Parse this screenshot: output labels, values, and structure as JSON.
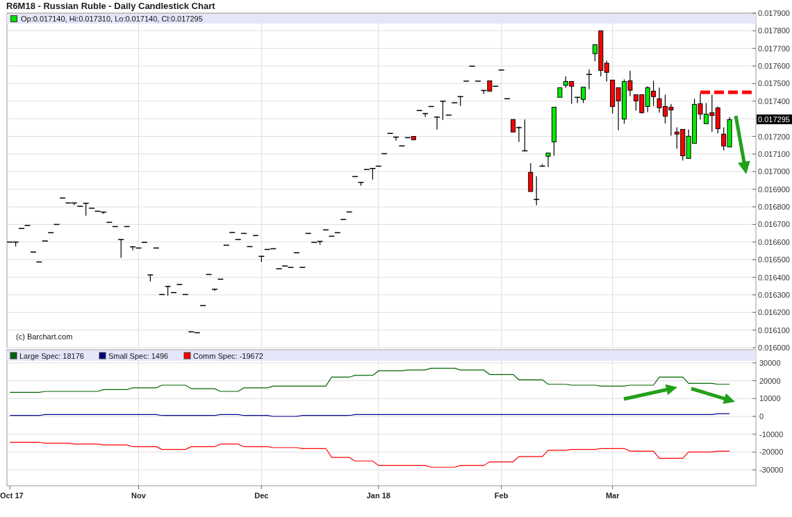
{
  "title": "R6M18 - Russian Ruble - Daily Candlestick Chart",
  "price_chart": {
    "legend": "Op:0.017140, Hi:0.017310, Lo:0.017140, Cl:0.017295",
    "credit": "(c) Barchart.com",
    "last_price_label": "0.017295",
    "chart_data": {
      "type": "candlestick",
      "grid": true,
      "ylim": [
        0.016,
        0.0179
      ],
      "yticks": [
        {
          "value": 0.0179,
          "label": "0.017900"
        },
        {
          "value": 0.0178,
          "label": "0.017800"
        },
        {
          "value": 0.0177,
          "label": "0.017700"
        },
        {
          "value": 0.0176,
          "label": "0.017600"
        },
        {
          "value": 0.0175,
          "label": "0.017500"
        },
        {
          "value": 0.0174,
          "label": "0.017400"
        },
        {
          "value": 0.0172,
          "label": "0.017200"
        },
        {
          "value": 0.0171,
          "label": "0.017100"
        },
        {
          "value": 0.017,
          "label": "0.017000"
        },
        {
          "value": 0.0169,
          "label": "0.016900"
        },
        {
          "value": 0.0168,
          "label": "0.016800"
        },
        {
          "value": 0.0167,
          "label": "0.016700"
        },
        {
          "value": 0.0166,
          "label": "0.016600"
        },
        {
          "value": 0.0165,
          "label": "0.016500"
        },
        {
          "value": 0.0164,
          "label": "0.016400"
        },
        {
          "value": 0.0163,
          "label": "0.016300"
        },
        {
          "value": 0.0162,
          "label": "0.016200"
        },
        {
          "value": 0.0161,
          "label": "0.016100"
        },
        {
          "value": 0.016,
          "label": "0.016000"
        }
      ],
      "categories": [
        null,
        null,
        null,
        null,
        null,
        null,
        null,
        null,
        null,
        null,
        null,
        null,
        null,
        null,
        null,
        null,
        null,
        null,
        null,
        null,
        null,
        null,
        null,
        null,
        null,
        null,
        null,
        null,
        null,
        null,
        null,
        null,
        null,
        null,
        null,
        null,
        null,
        null,
        null,
        null,
        null,
        null,
        null,
        null,
        null,
        null,
        null,
        null,
        null,
        null,
        null,
        null,
        null,
        null,
        null,
        null,
        null,
        null,
        null,
        null,
        null,
        null,
        null,
        null,
        null,
        null,
        null,
        null,
        null,
        null,
        null,
        null,
        null,
        null,
        null,
        null,
        null,
        null,
        null,
        null,
        null,
        null,
        null,
        null,
        null,
        null,
        null,
        null,
        null,
        null,
        null,
        null,
        null,
        null,
        null,
        null,
        null,
        null,
        null,
        null,
        null,
        null,
        null,
        null,
        null,
        null,
        null,
        null,
        null,
        null,
        null,
        null,
        null,
        null,
        null,
        null,
        null,
        null,
        null,
        null,
        null,
        null,
        null,
        null,
        null,
        null,
        null,
        null
      ],
      "ohlc": [
        [
          0.0166,
          0.0166,
          0.0166,
          0.0166
        ],
        [
          0.0166,
          0.0166,
          0.016575,
          0.0166
        ],
        [
          0.016677,
          0.016677,
          0.016677,
          0.016677
        ],
        [
          0.016694,
          0.016694,
          0.016694,
          0.016694
        ],
        [
          0.016543,
          0.016543,
          0.016543,
          0.016543
        ],
        [
          0.016487,
          0.016487,
          0.016487,
          0.016487
        ],
        [
          0.016606,
          0.016606,
          0.016606,
          0.016606
        ],
        [
          0.016653,
          0.016653,
          0.016653,
          0.016653
        ],
        [
          0.0167,
          0.0167,
          0.0167,
          0.0167
        ],
        [
          0.01685,
          0.01685,
          0.01685,
          0.01685
        ],
        [
          0.016822,
          0.016822,
          0.016822,
          0.016822
        ],
        [
          0.016822,
          0.016822,
          0.01681,
          0.016822
        ],
        [
          0.016803,
          0.016803,
          0.016803,
          0.016803
        ],
        [
          0.01682,
          0.01682,
          0.01675,
          0.01682
        ],
        [
          0.016792,
          0.016792,
          0.016792,
          0.016792
        ],
        [
          0.016775,
          0.016775,
          0.016775,
          0.016775
        ],
        [
          0.01677,
          0.01677,
          0.01676,
          0.01677
        ],
        [
          0.016712,
          0.016712,
          0.016712,
          0.016712
        ],
        [
          0.016688,
          0.016688,
          0.016688,
          0.016688
        ],
        [
          0.016614,
          0.016614,
          0.01651,
          0.016614
        ],
        [
          0.016688,
          0.016688,
          0.016688,
          0.016688
        ],
        [
          0.016573,
          0.016573,
          0.016553,
          0.016573
        ],
        [
          0.016566,
          0.016566,
          0.016566,
          0.016566
        ],
        [
          0.016598,
          0.016598,
          0.016598,
          0.016598
        ],
        [
          0.016413,
          0.016413,
          0.016376,
          0.016413
        ],
        [
          0.016566,
          0.016566,
          0.016566,
          0.016566
        ],
        [
          0.016302,
          0.016302,
          0.016302,
          0.016302
        ],
        [
          0.016348,
          0.016348,
          0.016296,
          0.016348
        ],
        [
          0.016313,
          0.016313,
          0.016313,
          0.016313
        ],
        [
          0.016359,
          0.016359,
          0.016359,
          0.016359
        ],
        [
          0.016302,
          0.016302,
          0.016302,
          0.016302
        ],
        [
          0.01609,
          0.01609,
          0.01609,
          0.01609
        ],
        [
          0.016085,
          0.016085,
          0.016085,
          0.016085
        ],
        [
          0.016239,
          0.016239,
          0.016239,
          0.016239
        ],
        [
          0.016416,
          0.016416,
          0.016416,
          0.016416
        ],
        [
          0.016332,
          0.016332,
          0.016322,
          0.016332
        ],
        [
          0.016389,
          0.016389,
          0.016389,
          0.016389
        ],
        [
          0.016582,
          0.016582,
          0.016582,
          0.016582
        ],
        [
          0.016654,
          0.016654,
          0.016654,
          0.016654
        ],
        [
          0.016614,
          0.016614,
          0.016614,
          0.016614
        ],
        [
          0.016649,
          0.016649,
          0.016649,
          0.016649
        ],
        [
          0.016574,
          0.016574,
          0.016574,
          0.016574
        ],
        [
          0.016637,
          0.016637,
          0.016637,
          0.016637
        ],
        [
          0.016519,
          0.016519,
          0.016487,
          0.016519
        ],
        [
          0.016558,
          0.016558,
          0.016558,
          0.016558
        ],
        [
          0.016562,
          0.016562,
          0.016562,
          0.016562
        ],
        [
          0.016448,
          0.016448,
          0.016448,
          0.016448
        ],
        [
          0.016464,
          0.016464,
          0.016464,
          0.016464
        ],
        [
          0.016456,
          0.016456,
          0.016456,
          0.016456
        ],
        [
          0.016539,
          0.016539,
          0.016539,
          0.016539
        ],
        [
          0.016456,
          0.016456,
          0.016456,
          0.016456
        ],
        [
          0.016649,
          0.016649,
          0.016649,
          0.016649
        ],
        [
          0.016598,
          0.016598,
          0.016598,
          0.016598
        ],
        [
          0.016604,
          0.016604,
          0.016585,
          0.016604
        ],
        [
          0.016669,
          0.016669,
          0.016669,
          0.016669
        ],
        [
          0.016633,
          0.016633,
          0.016633,
          0.016633
        ],
        [
          0.016653,
          0.016653,
          0.016653,
          0.016653
        ],
        [
          0.016728,
          0.016728,
          0.016728,
          0.016728
        ],
        [
          0.016771,
          0.016771,
          0.016771,
          0.016771
        ],
        [
          0.016972,
          0.016972,
          0.016972,
          0.016972
        ],
        [
          0.016939,
          0.016939,
          0.01692,
          0.016939
        ],
        [
          0.017012,
          0.017012,
          0.017012,
          0.017012
        ],
        [
          0.017018,
          0.017018,
          0.016955,
          0.017018
        ],
        [
          0.017031,
          0.017031,
          0.017031,
          0.017031
        ],
        [
          0.017102,
          0.017102,
          0.017102,
          0.017102
        ],
        [
          0.017217,
          0.017217,
          0.017217,
          0.017217
        ],
        [
          0.017196,
          0.017196,
          0.017176,
          0.017196
        ],
        [
          0.017146,
          0.017146,
          0.017146,
          0.017146
        ],
        [
          0.017193,
          0.017193,
          0.017193,
          0.017193
        ],
        [
          0.0172,
          0.0172,
          0.017181,
          0.017181
        ],
        [
          0.017347,
          0.017347,
          0.017347,
          0.017347
        ],
        [
          0.01733,
          0.01733,
          0.017311,
          0.01733
        ],
        [
          0.01737,
          0.01737,
          0.01737,
          0.01737
        ],
        [
          0.01731,
          0.01731,
          0.017239,
          0.01731
        ],
        [
          0.0174,
          0.0174,
          0.017294,
          0.0174
        ],
        [
          0.017321,
          0.017321,
          0.017321,
          0.017321
        ],
        [
          0.017391,
          0.017391,
          0.017391,
          0.017391
        ],
        [
          0.017426,
          0.017426,
          0.017373,
          0.017426
        ],
        [
          0.017514,
          0.017514,
          0.017514,
          0.017514
        ],
        [
          0.017599,
          0.017599,
          0.017599,
          0.017599
        ],
        [
          0.017514,
          0.017514,
          0.017514,
          0.017514
        ],
        [
          0.017461,
          0.017461,
          0.017441,
          0.017461
        ],
        [
          0.017516,
          0.017516,
          0.017457,
          0.017457
        ],
        [
          0.017485,
          0.017485,
          0.017485,
          0.017485
        ],
        [
          0.017577,
          0.017577,
          0.017577,
          0.017577
        ],
        [
          0.017414,
          0.017414,
          0.017414,
          0.017414
        ],
        [
          0.017296,
          0.017296,
          0.017225,
          0.017225
        ],
        [
          0.01725,
          0.017256,
          0.017169,
          0.01725
        ],
        [
          0.017118,
          0.017296,
          0.017118,
          0.017118
        ],
        [
          0.016996,
          0.017049,
          0.016887,
          0.016887
        ],
        [
          0.016842,
          0.016974,
          0.016809,
          0.016842
        ],
        [
          0.017031,
          0.017043,
          0.017031,
          0.017031
        ],
        [
          0.017087,
          0.017106,
          0.017026,
          0.017106
        ],
        [
          0.017169,
          0.017366,
          0.01709,
          0.017366
        ],
        [
          0.017422,
          0.017477,
          0.017422,
          0.017477
        ],
        [
          0.01749,
          0.017541,
          0.017476,
          0.017512
        ],
        [
          0.017512,
          0.017512,
          0.017385,
          0.017485
        ],
        [
          0.017422,
          0.017422,
          0.01739,
          0.017422
        ],
        [
          0.01741,
          0.01748,
          0.01739,
          0.01748
        ],
        [
          0.017552,
          0.017581,
          0.017468,
          0.017552
        ],
        [
          0.01767,
          0.017724,
          0.017627,
          0.017721
        ],
        [
          0.0178,
          0.0178,
          0.017541,
          0.017575
        ],
        [
          0.017616,
          0.01763,
          0.017512,
          0.017564
        ],
        [
          0.01752,
          0.01752,
          0.01733,
          0.01737
        ],
        [
          0.017477,
          0.017477,
          0.017235,
          0.017402
        ],
        [
          0.017299,
          0.017524,
          0.017272,
          0.017512
        ],
        [
          0.017516,
          0.017573,
          0.017428,
          0.017462
        ],
        [
          0.017437,
          0.017437,
          0.017347,
          0.017402
        ],
        [
          0.017437,
          0.017437,
          0.01733,
          0.017335
        ],
        [
          0.01737,
          0.017485,
          0.017338,
          0.017477
        ],
        [
          0.017457,
          0.017516,
          0.017373,
          0.017426
        ],
        [
          0.017414,
          0.017477,
          0.017335,
          0.017363
        ],
        [
          0.01737,
          0.017437,
          0.017274,
          0.017315
        ],
        [
          0.017366,
          0.017385,
          0.017204,
          0.01735
        ],
        [
          0.017225,
          0.017252,
          0.01713,
          0.017213
        ],
        [
          0.01724,
          0.01724,
          0.017063,
          0.01709
        ],
        [
          0.017075,
          0.01724,
          0.017075,
          0.017201
        ],
        [
          0.017161,
          0.017414,
          0.017161,
          0.017382
        ],
        [
          0.017386,
          0.017445,
          0.017296,
          0.017327
        ],
        [
          0.017272,
          0.01739,
          0.017272,
          0.017327
        ],
        [
          0.017335,
          0.017437,
          0.017225,
          0.017319
        ],
        [
          0.017362,
          0.01737,
          0.017217,
          0.017244
        ],
        [
          0.017213,
          0.017252,
          0.01712,
          0.017146
        ],
        [
          0.01714,
          0.01731,
          0.01714,
          0.017295
        ],
        null,
        null,
        null,
        null
      ]
    }
  },
  "cot_chart": {
    "chart_data": {
      "type": "line",
      "grid": true,
      "legend": true,
      "ylim": [
        -38900,
        37350
      ],
      "categories": [
        "Oct 17",
        null,
        null,
        null,
        null,
        null,
        null,
        null,
        null,
        null,
        null,
        null,
        null,
        null,
        null,
        null,
        null,
        null,
        null,
        null,
        null,
        null,
        "Nov",
        null,
        null,
        null,
        null,
        null,
        null,
        null,
        null,
        null,
        null,
        null,
        null,
        null,
        null,
        null,
        null,
        null,
        null,
        null,
        null,
        "Dec",
        null,
        null,
        null,
        null,
        null,
        null,
        null,
        null,
        null,
        null,
        null,
        null,
        null,
        null,
        null,
        null,
        null,
        null,
        null,
        "Jan 18",
        null,
        null,
        null,
        null,
        null,
        null,
        null,
        null,
        null,
        null,
        null,
        null,
        null,
        null,
        null,
        null,
        null,
        null,
        null,
        null,
        "Feb",
        null,
        null,
        null,
        null,
        null,
        null,
        null,
        null,
        null,
        null,
        null,
        null,
        null,
        null,
        null,
        null,
        null,
        null,
        "Mar",
        null,
        null,
        null,
        null,
        null,
        null,
        null,
        null,
        null,
        null,
        null,
        null,
        null,
        null,
        null,
        null,
        null,
        null,
        null,
        null,
        null,
        null,
        null,
        null
      ],
      "yticks": [
        30000,
        20000,
        10000,
        0,
        -10000,
        -20000,
        -30000
      ],
      "series": [
        {
          "name": "Large Spec: 18176",
          "color": "#006400",
          "values": [
            13500,
            13500,
            13500,
            13500,
            13500,
            13500,
            14000,
            14000,
            14000,
            14000,
            14000,
            14000,
            14000,
            14000,
            14000,
            14000,
            15000,
            15000,
            15000,
            15000,
            15000,
            16000,
            16000,
            16000,
            16000,
            16000,
            17500,
            17500,
            17500,
            17500,
            17500,
            15500,
            15500,
            15500,
            15500,
            15500,
            14000,
            14000,
            14000,
            14000,
            16000,
            16000,
            16000,
            16000,
            16000,
            17000,
            17000,
            17000,
            17000,
            17000,
            17000,
            17000,
            17000,
            17000,
            17000,
            22000,
            22000,
            22000,
            22000,
            23000,
            23000,
            23000,
            23000,
            25500,
            25500,
            25500,
            25500,
            25500,
            26000,
            26000,
            26000,
            26000,
            27000,
            27000,
            27000,
            27000,
            27000,
            26000,
            26000,
            26000,
            26000,
            26000,
            23500,
            23500,
            23500,
            23500,
            23500,
            20500,
            20500,
            20500,
            20500,
            20500,
            18000,
            18000,
            18000,
            18000,
            17500,
            17500,
            17500,
            17500,
            17500,
            17000,
            17000,
            17000,
            17000,
            17000,
            17500,
            17500,
            17500,
            17500,
            17500,
            22000,
            22000,
            22000,
            22000,
            22000,
            18500,
            18500,
            18500,
            18500,
            18500,
            18000,
            18000,
            18000,
            null,
            null,
            null,
            null
          ]
        },
        {
          "name": "Small Spec: 1496",
          "color": "#00008b",
          "values": [
            500,
            500,
            500,
            500,
            500,
            500,
            1000,
            1000,
            1000,
            1000,
            1000,
            1000,
            1000,
            1000,
            1000,
            1000,
            1000,
            1000,
            1000,
            1000,
            1000,
            1000,
            1000,
            1000,
            1000,
            1000,
            500,
            500,
            500,
            500,
            500,
            500,
            500,
            500,
            500,
            500,
            1000,
            1000,
            1000,
            1000,
            500,
            500,
            500,
            500,
            500,
            0,
            0,
            0,
            0,
            0,
            500,
            500,
            500,
            500,
            500,
            500,
            500,
            500,
            500,
            1000,
            1000,
            1000,
            1000,
            1000,
            1000,
            1000,
            1000,
            1000,
            1000,
            1000,
            1000,
            1000,
            1000,
            1000,
            1000,
            1000,
            1000,
            1000,
            1000,
            1000,
            1000,
            1000,
            1000,
            1000,
            1000,
            1000,
            1000,
            1000,
            1000,
            1000,
            1000,
            1000,
            1000,
            1000,
            1000,
            1000,
            1000,
            1000,
            1000,
            1000,
            1000,
            1000,
            1000,
            1000,
            1000,
            1000,
            1000,
            1000,
            1000,
            1000,
            1000,
            1000,
            1000,
            1000,
            1000,
            1000,
            1000,
            1000,
            1000,
            1000,
            1000,
            1500,
            1500,
            1500,
            null,
            null,
            null,
            null
          ]
        },
        {
          "name": "Comm Spec: -19672",
          "color": "#ff0000",
          "values": [
            -14500,
            -14500,
            -14500,
            -14500,
            -14500,
            -14500,
            -15000,
            -15000,
            -15000,
            -15000,
            -15000,
            -15500,
            -15500,
            -15500,
            -15500,
            -15500,
            -16000,
            -16000,
            -16000,
            -16000,
            -16000,
            -17000,
            -17000,
            -17000,
            -17000,
            -17000,
            -18500,
            -18500,
            -18500,
            -18500,
            -18500,
            -17000,
            -17000,
            -17000,
            -17000,
            -17000,
            -15500,
            -15500,
            -15500,
            -15500,
            -17000,
            -17000,
            -17000,
            -17000,
            -17000,
            -17500,
            -17500,
            -17500,
            -17500,
            -17500,
            -18000,
            -18000,
            -18000,
            -18000,
            -18000,
            -23000,
            -23000,
            -23000,
            -23000,
            -25000,
            -25000,
            -25000,
            -25000,
            -27500,
            -27500,
            -27500,
            -27500,
            -27500,
            -27500,
            -27500,
            -27500,
            -27500,
            -28500,
            -28500,
            -28500,
            -28500,
            -28500,
            -27500,
            -27500,
            -27500,
            -27500,
            -27500,
            -25500,
            -25500,
            -25500,
            -25500,
            -25500,
            -22500,
            -22500,
            -22500,
            -22500,
            -22500,
            -19000,
            -19000,
            -19000,
            -19000,
            -18500,
            -18500,
            -18500,
            -18500,
            -18500,
            -18000,
            -18000,
            -18000,
            -18000,
            -18000,
            -19500,
            -19500,
            -19500,
            -19500,
            -19500,
            -23500,
            -23500,
            -23500,
            -23500,
            -23500,
            -20000,
            -20000,
            -20000,
            -20000,
            -20000,
            -19500,
            -19500,
            -19500,
            null,
            null,
            null,
            null
          ]
        }
      ]
    }
  }
}
